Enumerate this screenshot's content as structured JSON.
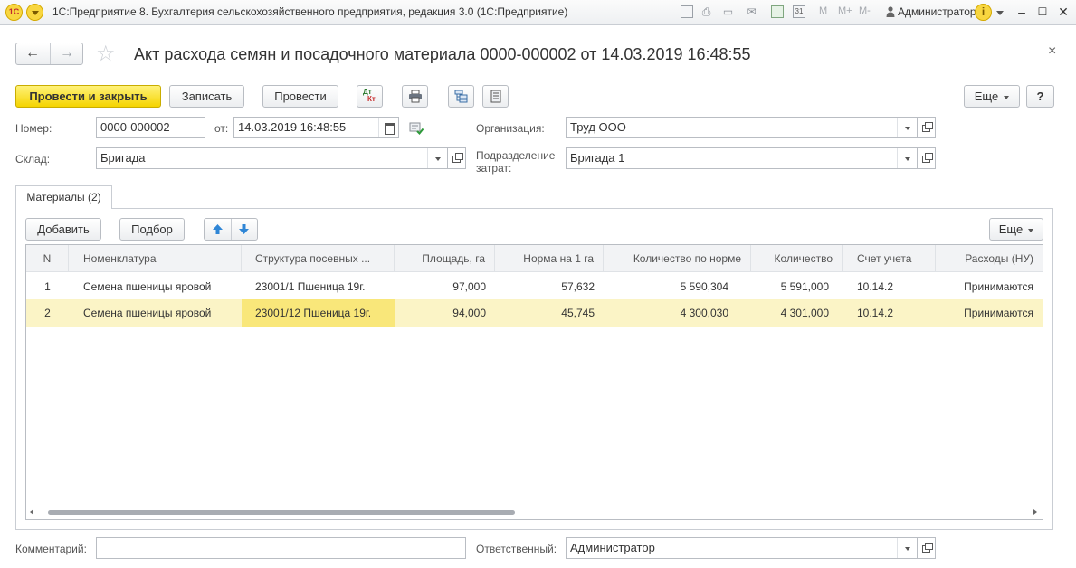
{
  "titlebar": {
    "logo": "1С",
    "title": "1С:Предприятие 8. Бухгалтерия сельскохозяйственного предприятия, редакция 3.0  (1С:Предприятие)",
    "calendar_day": "31",
    "m_label": "M",
    "m_plus_label": "M+",
    "m_minus_label": "M-",
    "user": "Администратор",
    "info_icon": "i"
  },
  "header": {
    "back_icon": "arrow-left-icon",
    "forward_icon": "arrow-right-icon",
    "doc_title": "Акт расхода семян и посадочного материала 0000-000002 от 14.03.2019 16:48:55"
  },
  "toolbar": {
    "post_close": "Провести и закрыть",
    "save": "Записать",
    "post": "Провести",
    "dt_label": "Дт",
    "kt_label": "Кт",
    "more": "Еще",
    "help": "?"
  },
  "form": {
    "number_label": "Номер:",
    "number_value": "0000-000002",
    "date_label": "от:",
    "date_value": "14.03.2019 16:48:55",
    "org_label": "Организация:",
    "org_value": "Труд ООО",
    "warehouse_label": "Склад:",
    "warehouse_value": "Бригада",
    "dept_label": "Подразделение затрат:",
    "dept_value": "Бригада 1",
    "comment_label": "Комментарий:",
    "comment_value": "",
    "responsible_label": "Ответственный:",
    "responsible_value": "Администратор"
  },
  "tab": {
    "materials": "Материалы (2)"
  },
  "table_toolbar": {
    "add": "Добавить",
    "pick": "Подбор",
    "more": "Еще"
  },
  "table": {
    "columns": [
      "N",
      "Номенклатура",
      "Структура посевных ...",
      "Площадь, га",
      "Норма на 1 га",
      "Количество по норме",
      "Количество",
      "Счет учета",
      "Расходы (НУ)"
    ],
    "rows": [
      [
        "1",
        "Семена пшеницы яровой",
        "23001/1 Пшеница 19г.",
        "97,000",
        "57,632",
        "5 590,304",
        "5 591,000",
        "10.14.2",
        "Принимаются"
      ],
      [
        "2",
        "Семена пшеницы яровой",
        "23001/12 Пшеница 19г.",
        "94,000",
        "45,745",
        "4 300,030",
        "4 301,000",
        "10.14.2",
        "Принимаются"
      ]
    ],
    "selected_row": 2
  }
}
